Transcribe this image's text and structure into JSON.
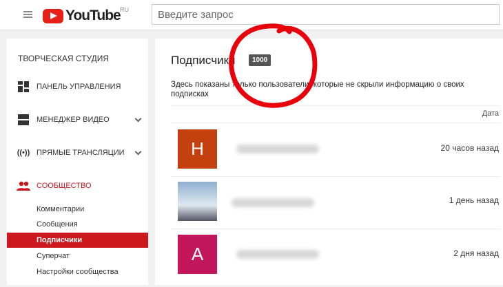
{
  "header": {
    "logo_text": "YouTube",
    "logo_region": "RU",
    "search_placeholder": "Введите запрос"
  },
  "sidebar": {
    "title": "ТВОРЧЕСКАЯ СТУДИЯ",
    "items": [
      {
        "label": "ПАНЕЛЬ УПРАВЛЕНИЯ",
        "icon": "dashboard-icon"
      },
      {
        "label": "МЕНЕДЖЕР ВИДЕО",
        "icon": "video-manager-icon"
      },
      {
        "label": "ПРЯМЫЕ ТРАНСЛЯЦИИ",
        "icon": "live-icon"
      },
      {
        "label": "СООБЩЕСТВО",
        "icon": "community-icon"
      }
    ],
    "community_sub": [
      "Комментарии",
      "Сообщения",
      "Подписчики",
      "Суперчат",
      "Настройки сообщества"
    ],
    "accent": "#cc181e"
  },
  "main": {
    "title": "Подписчики",
    "count": "1000",
    "description": "Здесь показаны только пользователи, которые не скрыли информацию о своих подписках",
    "column_date": "Дата",
    "rows": [
      {
        "initial": "Н",
        "color": "#c4410f",
        "date": "20 часов назад"
      },
      {
        "initial": "",
        "color": "#8aa6c4",
        "date": "1 день назад"
      },
      {
        "initial": "А",
        "color": "#c2185b",
        "date": "2 дня назад"
      }
    ]
  }
}
